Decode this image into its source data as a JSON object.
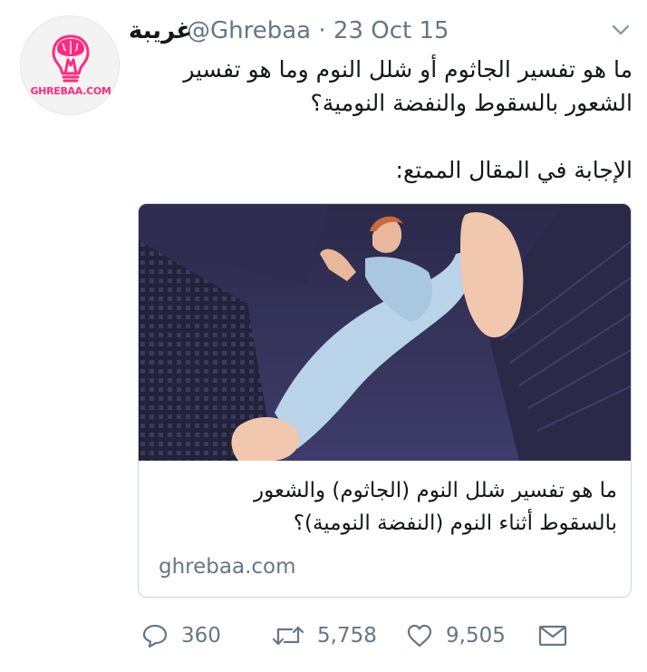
{
  "tweet": {
    "display_name": "غريبة",
    "handle": "@Ghrebaa",
    "separator": "·",
    "date": "23 Oct 15",
    "avatar_text": "GHREBAA.COM",
    "lines": [
      "ما هو تفسير الجاثوم أو شلل النوم وما هو تفسير",
      "الشعور بالسقوط والنفضة النومية؟"
    ],
    "lead": "الإجابة في المقال الممتع:"
  },
  "card": {
    "title_lines": [
      "ما هو تفسير شلل النوم (الجاثوم) والشعور",
      "بالسقوط أثناء النوم (النفضة النومية)؟"
    ],
    "domain": "ghrebaa.com"
  },
  "actions": {
    "replies": "360",
    "retweets": "5,758",
    "likes": "9,505"
  },
  "icons": {
    "reply": "speech-bubble-icon",
    "retweet": "retweet-arrows-icon",
    "like": "heart-icon",
    "dm": "envelope-icon",
    "menu": "chevron-down-icon",
    "brand": "lightbulb-brain-icon"
  },
  "colors": {
    "brand_pink": "#ff2a7f",
    "muted": "#657786",
    "text": "#14171a",
    "border": "#ccd6dd"
  }
}
